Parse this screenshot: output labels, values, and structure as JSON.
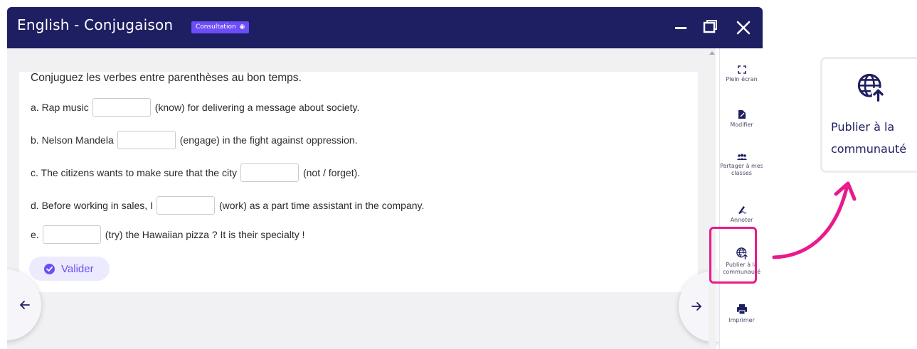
{
  "window": {
    "title": "English - Conjugaison",
    "badge": "Consultation",
    "controls": [
      "minimize-icon",
      "restore-icon",
      "close-icon"
    ]
  },
  "exercise": {
    "instruction": "Conjuguez les verbes entre parenthèses au bon temps.",
    "lines": [
      {
        "before": "a. Rap music",
        "value": "",
        "after": "(know) for delivering a message about society."
      },
      {
        "before": "b. Nelson Mandela",
        "value": "",
        "after": "(engage) in the fight against oppression."
      },
      {
        "before": "c. The citizens wants to make sure that the city",
        "value": "",
        "after": "(not / forget)."
      },
      {
        "before": "d. Before working in sales, I",
        "value": "",
        "after": "(work) as a part time assistant in the company."
      },
      {
        "before": "e.",
        "value": "",
        "after": "(try) the Hawaiian pizza ? It is their specialty !"
      }
    ],
    "validate_label": "Valider"
  },
  "sidebar": {
    "items": [
      {
        "label": "Plein écran",
        "icon": "fullscreen-icon"
      },
      {
        "label": "Modifier",
        "icon": "edit-icon"
      },
      {
        "label": "Partager à mes classes",
        "icon": "users-icon"
      },
      {
        "label": "Annoter",
        "icon": "pen-icon"
      },
      {
        "label": "Publier à la communauté",
        "icon": "globe-upload-icon"
      },
      {
        "label": "Imprimer",
        "icon": "printer-icon"
      }
    ]
  },
  "callout": {
    "label": "Publier à la communauté",
    "icon": "globe-upload-icon"
  },
  "colors": {
    "titlebar": "#1e1e62",
    "accent": "#6c4df6",
    "highlight": "#e81a8c"
  }
}
